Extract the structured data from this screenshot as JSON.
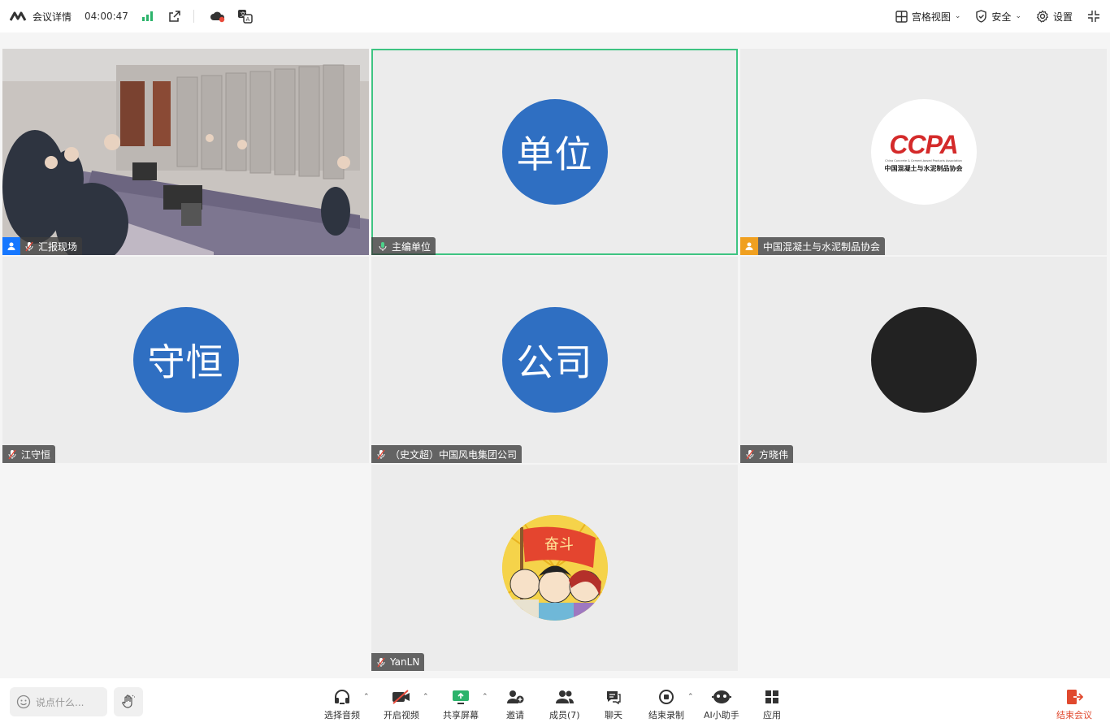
{
  "topbar": {
    "meeting_details": "会议详情",
    "timer": "04:00:47",
    "grid_view": "宫格视图",
    "security": "安全",
    "settings": "设置"
  },
  "tiles": [
    {
      "name": "汇报现场"
    },
    {
      "name": "主编单位",
      "avatar_text": "单位"
    },
    {
      "name": "中国混凝土与水泥制品协会",
      "logo_main": "CCPA",
      "logo_en": "China Concrete & Cement-based Products Association",
      "logo_cn": "中国混凝土与水泥制品协会"
    },
    {
      "name": "江守恒",
      "avatar_text": "守恒"
    },
    {
      "name": "（史文超）中国风电集团公司",
      "avatar_text": "公司"
    },
    {
      "name": "方晓伟"
    },
    {
      "name": "YanLN",
      "banner_text": "奋斗"
    }
  ],
  "bottombar": {
    "chat_placeholder": "说点什么...",
    "tools": {
      "audio": "选择音频",
      "video": "开启视频",
      "share": "共享屏幕",
      "invite": "邀请",
      "members": "成员(7)",
      "chat": "聊天",
      "record": "结束录制",
      "ai": "AI小助手",
      "apps": "应用",
      "end": "结束会议"
    }
  },
  "colors": {
    "active_border": "#3ec482",
    "avatar_blue": "#2f6fc2",
    "end_red": "#e0492e",
    "ccpa_red": "#d42a2a"
  }
}
